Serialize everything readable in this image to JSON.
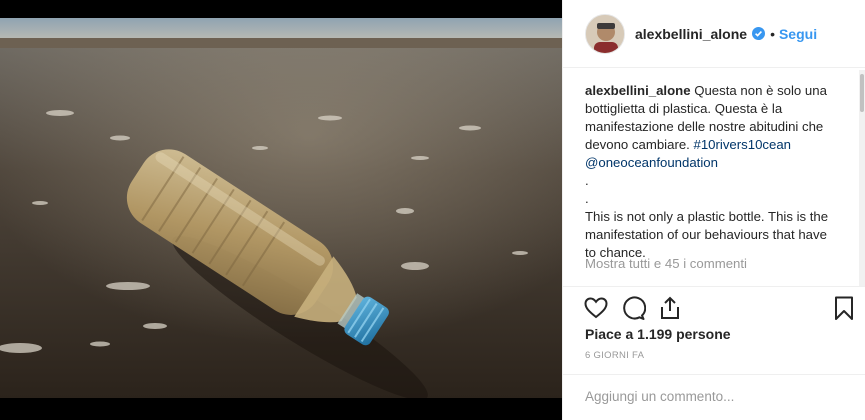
{
  "post": {
    "username": "alexbellini_alone",
    "follow_label": "Segui",
    "separator": "•",
    "caption_lines": [
      "Questa non è solo una",
      "bottiglietta di plastica. Questa è la",
      "manifestazione delle nostre abitudini che",
      "devono cambiare."
    ],
    "hashtag": "#10rivers10cean",
    "mention": "@oneoceanfoundation",
    "dot_lines": [
      ".",
      "."
    ],
    "english_lines": [
      "This is not only a plastic bottle. This is the",
      "manifestation of our behaviours that have",
      "to chance."
    ],
    "view_all_comments": "Mostra tutti e 45 i commenti",
    "likes": "Piace a 1.199 persone",
    "time": "6 GIORNI FA",
    "comment_placeholder": "Aggiungi un commento..."
  },
  "icons": {
    "verified": "verified-badge-icon",
    "like": "heart-icon",
    "comment": "comment-icon",
    "share": "share-icon",
    "save": "bookmark-icon"
  },
  "colors": {
    "link": "#003569",
    "follow": "#3897f0",
    "muted": "#999999",
    "text": "#262626"
  }
}
